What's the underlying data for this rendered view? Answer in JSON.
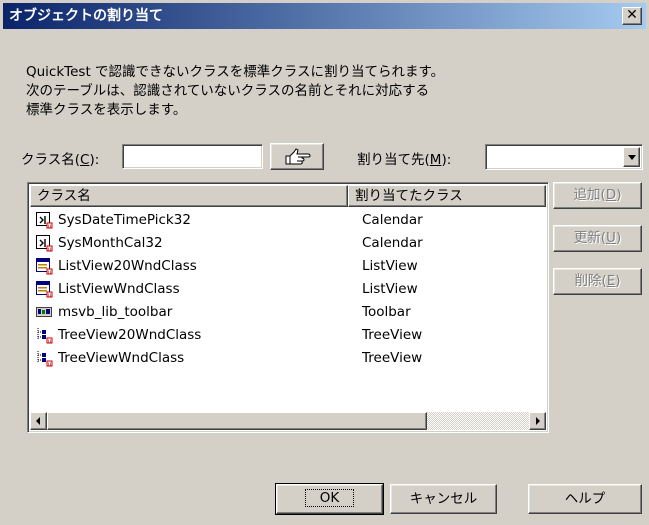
{
  "window": {
    "title": "オブジェクトの割り当て",
    "close_label": "✕"
  },
  "description": {
    "lines": [
      "QuickTest で認識できないクラスを標準クラスに割り当てられます。",
      "次のテーブルは、認識されていないクラスの名前とそれに対応する",
      "標準クラスを表示します。"
    ]
  },
  "class_name": {
    "label": "クラス名",
    "accel": "C",
    "value": ""
  },
  "pointer_icon": "pointing-hand-icon",
  "map_to": {
    "label": "割り当て先",
    "accel": "M",
    "value": ""
  },
  "table": {
    "columns": [
      "クラス名",
      "割り当てたクラス"
    ],
    "rows": [
      {
        "name": "SysDateTimePick32",
        "class": "Calendar",
        "icon": "calendar-icon"
      },
      {
        "name": "SysMonthCal32",
        "class": "Calendar",
        "icon": "calendar-icon"
      },
      {
        "name": "ListView20WndClass",
        "class": "ListView",
        "icon": "listview-icon"
      },
      {
        "name": "ListViewWndClass",
        "class": "ListView",
        "icon": "listview-icon"
      },
      {
        "name": "msvb_lib_toolbar",
        "class": "Toolbar",
        "icon": "toolbar-icon"
      },
      {
        "name": "TreeView20WndClass",
        "class": "TreeView",
        "icon": "treeview-icon"
      },
      {
        "name": "TreeViewWndClass",
        "class": "TreeView",
        "icon": "treeview-icon"
      }
    ]
  },
  "side_buttons": {
    "add": {
      "label": "追加",
      "accel": "D"
    },
    "update": {
      "label": "更新",
      "accel": "U"
    },
    "delete": {
      "label": "削除",
      "accel": "E"
    }
  },
  "footer": {
    "ok": "OK",
    "cancel": "キャンセル",
    "help": "ヘルプ"
  },
  "colors": {
    "title_start": "#0a246a",
    "title_end": "#a6caf0",
    "face": "#d4d0c8",
    "disabled_text": "#808080"
  }
}
